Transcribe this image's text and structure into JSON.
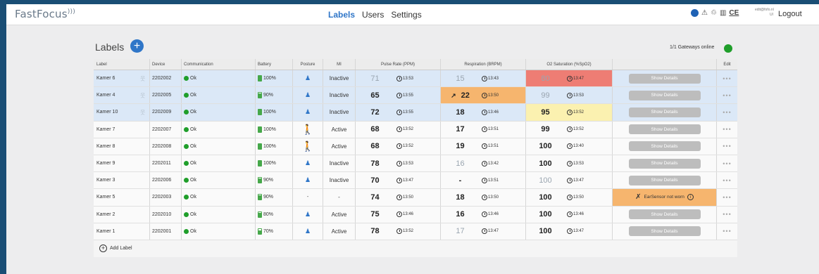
{
  "header": {
    "logo": "FastFocus",
    "nav": [
      "Labels",
      "Users",
      "Settings"
    ],
    "active_nav": "Labels",
    "user_info": "edit@fofo.nl\nUI",
    "logout": "Logout",
    "accent": "#2f76c8"
  },
  "page": {
    "title": "Labels",
    "gateways": "1/1 Gateways online"
  },
  "columns": [
    "Label",
    "Device",
    "Communication",
    "Battery",
    "Posture",
    "MI",
    "Pulse Rate (PPM)",
    "Respiration (BRPM)",
    "O2 Saturation (%SpO2)",
    "",
    "Edit"
  ],
  "rows": [
    {
      "label": "Kamer 6",
      "device": "2202002",
      "comm": "Ok",
      "battery": "100%",
      "batt_level": 1.0,
      "posture": "lying",
      "mi": "Inactive",
      "pulse": "71",
      "pulse_faded": true,
      "pulse_time": "13:53",
      "resp": "15",
      "resp_faded": true,
      "resp_time": "13:43",
      "o2": "80",
      "o2_faded": true,
      "o2_time": "13:47",
      "o2_alert": "red",
      "details": "Show Details",
      "row_color": "blue"
    },
    {
      "label": "Kamer 4",
      "device": "2202005",
      "comm": "Ok",
      "battery": "90%",
      "batt_level": 0.9,
      "posture": "lying",
      "mi": "Inactive",
      "pulse": "65",
      "pulse_time": "13:55",
      "resp": "22",
      "resp_trend": true,
      "resp_time": "13:50",
      "resp_alert": "orange",
      "o2": "99",
      "o2_faded": true,
      "o2_time": "13:53",
      "details": "Show Details",
      "row_color": "blue"
    },
    {
      "label": "Kamer 10",
      "device": "2202009",
      "comm": "Ok",
      "battery": "100%",
      "batt_level": 1.0,
      "posture": "lying",
      "mi": "Inactive",
      "pulse": "72",
      "pulse_time": "13:55",
      "resp": "18",
      "resp_time": "13:46",
      "o2": "95",
      "o2_time": "13:52",
      "o2_alert": "yellow",
      "details": "Show Details",
      "row_color": "blue"
    },
    {
      "label": "Kamer 7",
      "device": "2202007",
      "comm": "Ok",
      "battery": "100%",
      "batt_level": 1.0,
      "posture": "standing",
      "mi": "Active",
      "pulse": "68",
      "pulse_time": "13:52",
      "resp": "17",
      "resp_time": "13:51",
      "o2": "99",
      "o2_time": "13:52",
      "details": "Show Details",
      "row_color": "white"
    },
    {
      "label": "Kamer 8",
      "device": "2202008",
      "comm": "Ok",
      "battery": "100%",
      "batt_level": 1.0,
      "posture": "standing",
      "mi": "Active",
      "pulse": "68",
      "pulse_time": "13:52",
      "resp": "19",
      "resp_time": "13:51",
      "o2": "100",
      "o2_time": "13:40",
      "details": "Show Details",
      "row_color": "white"
    },
    {
      "label": "Kamer 9",
      "device": "2202011",
      "comm": "Ok",
      "battery": "100%",
      "batt_level": 1.0,
      "posture": "lying",
      "mi": "Inactive",
      "pulse": "78",
      "pulse_time": "13:53",
      "resp": "16",
      "resp_faded": true,
      "resp_time": "13:42",
      "o2": "100",
      "o2_time": "13:53",
      "details": "Show Details",
      "row_color": "white"
    },
    {
      "label": "Kamer 3",
      "device": "2202006",
      "comm": "Ok",
      "battery": "90%",
      "batt_level": 0.9,
      "posture": "lying",
      "mi": "Inactive",
      "pulse": "70",
      "pulse_time": "13:47",
      "resp": "-",
      "resp_time": "13:51",
      "o2": "100",
      "o2_faded": true,
      "o2_time": "13:47",
      "details": "Show Details",
      "row_color": "white"
    },
    {
      "label": "Kamer 5",
      "device": "2202003",
      "comm": "Ok",
      "battery": "90%",
      "batt_level": 0.9,
      "posture": "none",
      "mi": "-",
      "pulse": "74",
      "pulse_time": "13:50",
      "resp": "18",
      "resp_time": "13:50",
      "o2": "100",
      "o2_time": "13:50",
      "details": "EarSensor not worn",
      "warning": true,
      "row_color": "white"
    },
    {
      "label": "Kamer 2",
      "device": "2202010",
      "comm": "Ok",
      "battery": "80%",
      "batt_level": 0.8,
      "posture": "lying",
      "mi": "Active",
      "pulse": "75",
      "pulse_time": "13:46",
      "resp": "16",
      "resp_time": "13:46",
      "o2": "100",
      "o2_time": "13:46",
      "details": "Show Details",
      "row_color": "white"
    },
    {
      "label": "Kamer 1",
      "device": "2202001",
      "comm": "Ok",
      "battery": "70%",
      "batt_level": 0.7,
      "posture": "lying",
      "mi": "Active",
      "pulse": "78",
      "pulse_time": "13:52",
      "resp": "17",
      "resp_faded": true,
      "resp_time": "13:47",
      "o2": "100",
      "o2_time": "13:47",
      "details": "Show Details",
      "row_color": "white"
    }
  ],
  "add_label": "Add Label",
  "colors": {
    "ok": "#1f9e2a",
    "alert_red": "#ee7d74",
    "alert_orange": "#f6b56e",
    "alert_yellow": "#fbf1b0",
    "row_blue": "#dbe8f7"
  },
  "icons": {
    "posture_lying": "person-lying-icon",
    "posture_standing": "person-standing-icon",
    "time": "clock-icon",
    "trend": "trend-up-icon",
    "edit": "more-dots-icon"
  }
}
